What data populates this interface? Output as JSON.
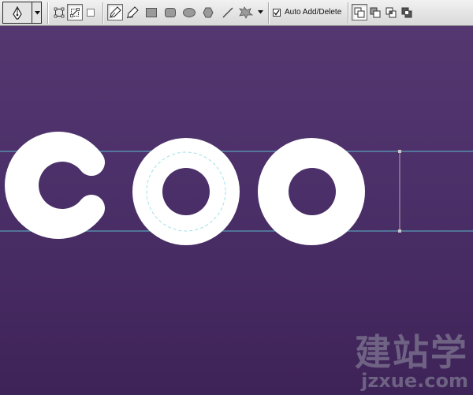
{
  "options_bar": {
    "tool": "pen-tool",
    "auto_add_delete": {
      "label": "Auto Add/Delete",
      "checked": true
    }
  },
  "canvas": {
    "background_top": "#553770",
    "background_bottom": "#3e2358",
    "glyph_color": "#ffffff",
    "guide_color": "#5fd3e0",
    "letters": [
      "C",
      "O",
      "O"
    ]
  },
  "watermark": {
    "chinese": "建站学",
    "url": "jzxue.com"
  }
}
